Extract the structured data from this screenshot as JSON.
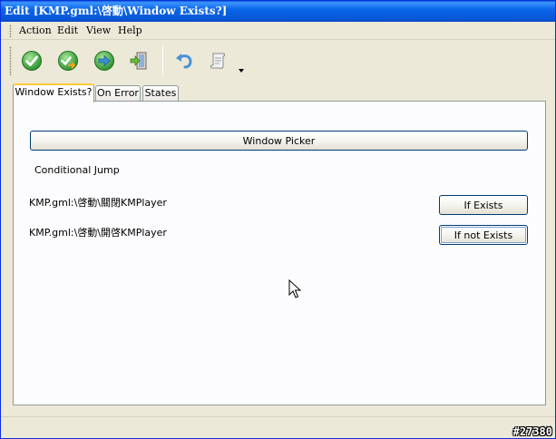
{
  "window": {
    "title": "Edit [KMP.gml:\\啓動\\Window Exists?]"
  },
  "menubar": {
    "items": [
      {
        "label": "Action"
      },
      {
        "label": "Edit"
      },
      {
        "label": "View"
      },
      {
        "label": "Help"
      }
    ]
  },
  "toolbar": {
    "buttons": [
      {
        "icon": "check-icon",
        "color": "#3aa63a"
      },
      {
        "icon": "check-arrow-icon",
        "color": "#3aa63a"
      },
      {
        "icon": "arrow-right-icon",
        "color": "#3a8fd6"
      },
      {
        "icon": "exit-door-icon",
        "color": "#6c9c3c"
      },
      {
        "icon": "undo-icon",
        "color": "#4a90d8"
      },
      {
        "icon": "scroll-icon",
        "color": "#9a9a9a"
      }
    ]
  },
  "tabs": [
    {
      "label": "Window Exists?",
      "active": true
    },
    {
      "label": "On Error",
      "active": false
    },
    {
      "label": "States",
      "active": false
    }
  ],
  "panel": {
    "window_picker_label": "Window Picker",
    "conditional_jump_label": "Conditional Jump",
    "rows": [
      {
        "path": "KMP.gml:\\啓動\\關閉KMPlayer",
        "button_label": "If Exists"
      },
      {
        "path": "KMP.gml:\\啓動\\開啓KMPlayer",
        "button_label": "If not Exists"
      }
    ]
  },
  "watermark": "#27380"
}
